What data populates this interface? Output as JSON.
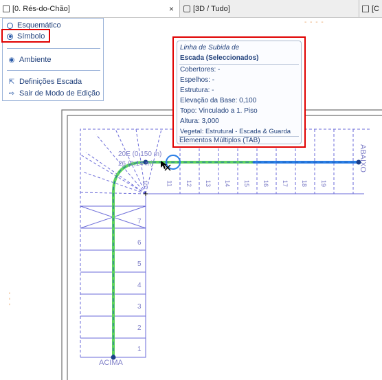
{
  "tabs": [
    {
      "label": "[0. Rés-do-Chão]",
      "close": "×"
    },
    {
      "label": "[3D / Tudo]"
    },
    {
      "label": "[C"
    }
  ],
  "panel": {
    "radio_options": [
      {
        "label": "Esquemático",
        "selected": false
      },
      {
        "label": "Símbolo",
        "selected": true
      }
    ],
    "environment_label": "Ambiente",
    "actions": [
      {
        "label": "Definições Escada",
        "icon": "stair-settings-icon"
      },
      {
        "label": "Sair de Modo de Edição",
        "icon": "exit-icon"
      }
    ]
  },
  "tooltip": {
    "title": "Linha de Subida de",
    "subtitle": "Escada (Seleccionados)",
    "properties": [
      "Cobertores: -",
      "Espelhos: -",
      "Estrutura: -",
      "Elevação da Base: 0,100",
      "Topo: Vinculado a 1. Piso",
      "Altura: 3,000",
      "Vegetal: Estrutural - Escada & Guarda"
    ],
    "footer": "Elementos Múltiplos (TAB)"
  },
  "plan": {
    "riser_info_1": "20E (0,150 m)",
    "riser_info_2": "26 (0,14 m)",
    "up_label": "ACIMA",
    "down_label": "ABAIXO",
    "step_numbers_lower": [
      "1",
      "2",
      "3",
      "4",
      "5",
      "6",
      "7"
    ],
    "step_numbers_upper": [
      "10",
      "11",
      "12",
      "13",
      "14",
      "15",
      "16",
      "17",
      "18",
      "19"
    ],
    "colors": {
      "walking_line_green": "#5fd35f",
      "walking_line_blue": "#2a7ee6",
      "stair_lines": "#6a6ad8",
      "highlight": "#e00000"
    }
  }
}
